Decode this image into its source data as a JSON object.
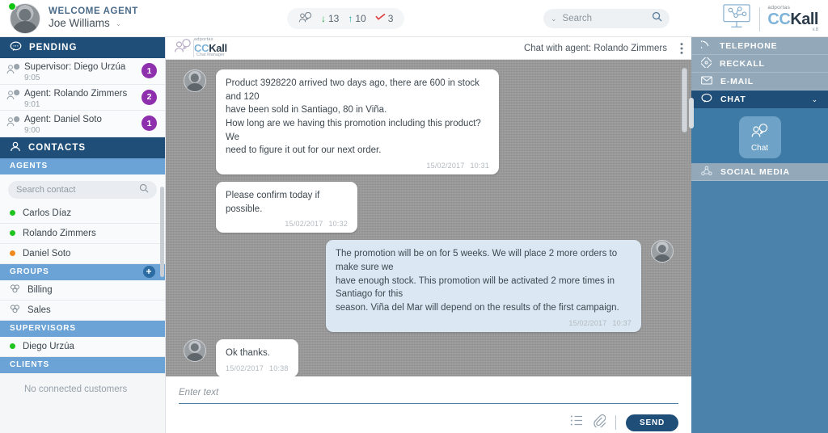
{
  "topbar": {
    "welcome_label": "WELCOME AGENT",
    "user_name": "Joe Williams",
    "user_chevron": "⌄",
    "status_color": "#12c412",
    "stats": {
      "inbound_label": "13",
      "outbound_label": "10",
      "missed_label": "3",
      "down_arrow": "↓",
      "up_arrow": "↑",
      "miss_glyph": "✓"
    },
    "search": {
      "placeholder": "Search",
      "chevron": "⌄"
    },
    "brand": {
      "sub": "adportas",
      "cc": "CC",
      "kall": "Kall",
      "version": "v.8"
    }
  },
  "sidebar": {
    "pending": {
      "title": "PENDING",
      "items": [
        {
          "name": "Supervisor: Diego Urzúa",
          "time": "9:05",
          "count": "1"
        },
        {
          "name": "Agent: Rolando Zimmers",
          "time": "9:01",
          "count": "2"
        },
        {
          "name": "Agent: Daniel Soto",
          "time": "9:00",
          "count": "1"
        }
      ]
    },
    "contacts": {
      "title": "CONTACTS",
      "agents_label": "AGENTS",
      "search_placeholder": "Search contact",
      "agents": [
        {
          "name": "Carlos Díaz",
          "status": "#1fc41f"
        },
        {
          "name": "Rolando Zimmers",
          "status": "#1fc41f"
        },
        {
          "name": "Daniel Soto",
          "status": "#f08a1e"
        }
      ],
      "groups_label": "GROUPS",
      "groups_add": "+",
      "groups": [
        {
          "name": "Billing"
        },
        {
          "name": "Sales"
        }
      ],
      "supervisors_label": "SUPERVISORS",
      "supervisors": [
        {
          "name": "Diego Urzúa",
          "status": "#1fc41f"
        }
      ],
      "clients_label": "CLIENTS",
      "clients_empty": "No connected customers"
    }
  },
  "chat": {
    "header": {
      "brand_sub": "adportas",
      "brand_cc": "CC",
      "brand_kall": "Kall",
      "brand_tag": "Chat Manager",
      "title": "Chat with agent: Rolando Zimmers",
      "menu": "⋮"
    },
    "messages": [
      {
        "direction": "in",
        "text": "Product 3928220 arrived two days ago, there are 600 in stock and 120\nhave been sold in Santiago, 80 in Viña.\nHow long are we having this promotion including this product? We\nneed to figure it out for our next order.",
        "date": "15/02/2017",
        "time": "10:31"
      },
      {
        "direction": "in",
        "text": "Please confirm today if possible.",
        "date": "15/02/2017",
        "time": "10:32"
      },
      {
        "direction": "out",
        "text": "The promotion will be on for 5 weeks. We will place 2 more orders to make sure we\nhave enough stock. This promotion will be activated 2 more times in Santiago for this\nseason. Viña del Mar will depend on the results of the first campaign.",
        "date": "15/02/2017",
        "time": "10:37"
      },
      {
        "direction": "in",
        "text": "Ok thanks.",
        "date": "15/02/2017",
        "time": "10:38"
      }
    ],
    "footer": {
      "input_placeholder": "Enter text",
      "send_label": "SEND"
    }
  },
  "channels": {
    "items": [
      {
        "label": "TELEPHONE",
        "icon": "phone-icon",
        "active": false
      },
      {
        "label": "RECKALL",
        "icon": "reckall-icon",
        "active": false
      },
      {
        "label": "E-MAIL",
        "icon": "envelope-icon",
        "active": false
      },
      {
        "label": "CHAT",
        "icon": "chat-bubble-icon",
        "active": true
      },
      {
        "label": "SOCIAL MEDIA",
        "icon": "social-icon",
        "active": false
      }
    ],
    "chat_tile_label": "Chat",
    "chat_chevron": "⌄"
  },
  "colors": {
    "dark_blue": "#1f4e79",
    "mid_blue": "#6ba3d6",
    "right_panel": "#4a82ab",
    "badge_purple": "#8e2fad",
    "bubble_out": "#dbe7f2"
  }
}
